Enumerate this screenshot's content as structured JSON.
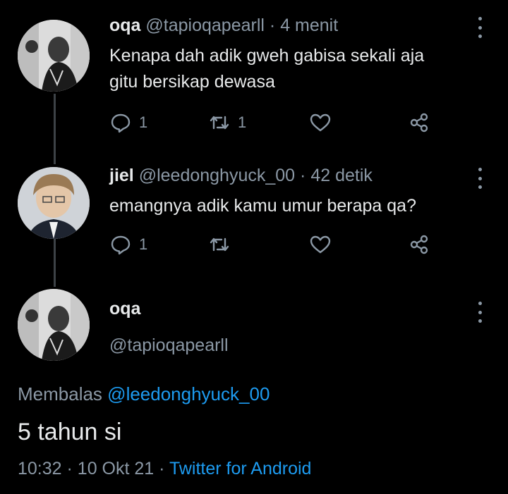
{
  "tweets": [
    {
      "name": "oqa",
      "handle": "@tapioqapearll",
      "time": "4 menit",
      "text_line1": "Kenapa dah adik gweh gabisa sekali aja",
      "text_line2": "gitu bersikap dewasa",
      "replies": "1",
      "retweets": "1",
      "likes": "",
      "separator": "·"
    },
    {
      "name": "jiel",
      "handle": "@leedonghyuck_00",
      "time": "42 detik",
      "text_line1": "emangnya adik kamu umur berapa qa?",
      "replies": "1",
      "retweets": "",
      "likes": "",
      "separator": "·"
    }
  ],
  "main_tweet": {
    "name": "oqa",
    "handle": "@tapioqapearll",
    "replying_label": "Membalas",
    "replying_to": "@leedonghyuck_00",
    "text": "5 tahun si",
    "time": "10:32",
    "date": "10 Okt 21",
    "source": "Twitter for Android",
    "separator": "·"
  },
  "colors": {
    "background": "#000000",
    "text": "#e7e9ea",
    "muted": "#8b98a5",
    "accent": "#1d9bf0"
  },
  "icons": [
    "reply-icon",
    "retweet-icon",
    "like-icon",
    "share-icon",
    "more-icon"
  ]
}
